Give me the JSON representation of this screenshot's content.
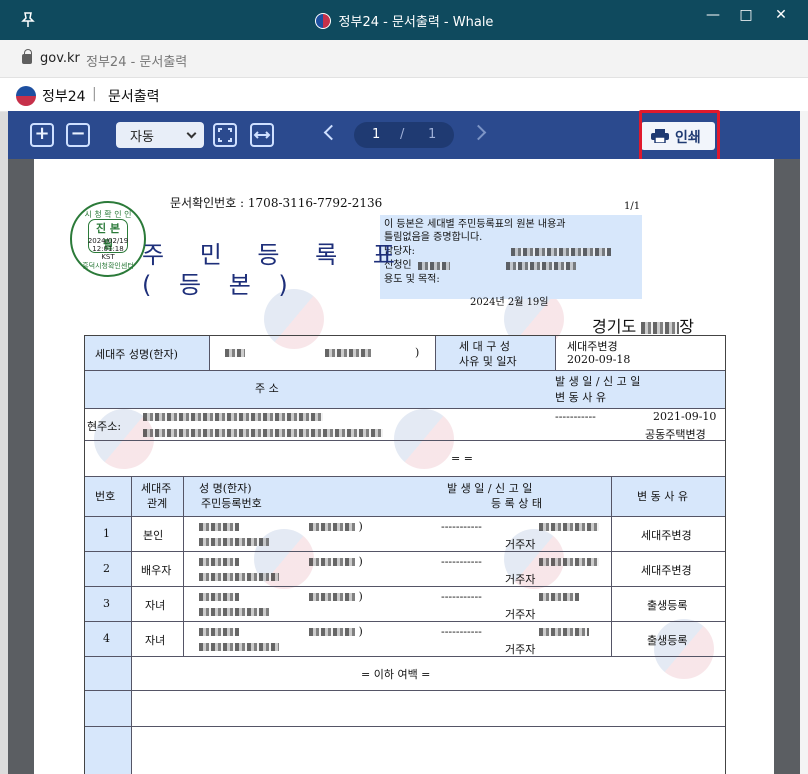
{
  "window": {
    "title": "정부24 - 문서출력 - Whale",
    "controls": [
      "—",
      "□",
      "✕"
    ]
  },
  "address": {
    "host": "gov.kr",
    "path": "정부24 - 문서출력"
  },
  "site": {
    "name": "정부24",
    "separator": "|",
    "page": "문서출력"
  },
  "toolbar": {
    "zoom_value": "자동",
    "page_current": "1",
    "page_sep": "/",
    "page_total": "1",
    "print_label": "인쇄"
  },
  "document": {
    "stamp": {
      "top": "시 청 확 인 인",
      "main": "진 본 필",
      "date": "2024/02/19",
      "time": "12:01:18",
      "tz": "KST",
      "bottom": "흥덕시청확인센터"
    },
    "doc_number": "문서확인번호 : 1708-3116-7792-2136",
    "page_of": "1/1",
    "cert_line1": "이 등본은 세대별 주민등록표의 원본 내용과",
    "cert_line2": "틀림없음을 증명합니다.",
    "cert_label_manager": "담당자:",
    "cert_label_applicant": "신청인",
    "cert_label_purpose": "용도 및 목적:",
    "title": "주 민 등 록 표",
    "subtitle": "( 등 본 )",
    "issue_date": "2024년 2월 19일",
    "issuer_prefix": "경기도",
    "issuer_suffix": "장",
    "head_name": "세대주 성명(한자)",
    "head_paren": ")",
    "composition_label1": "세 대 구 성",
    "composition_label2": "사유 및 일자",
    "composition_reason": "세대주변경",
    "composition_date": "2020-09-18",
    "address_header": "주          소",
    "address_hist_header1": "발 생 일  /  신 고 일",
    "address_hist_header2": "변    동    사    유",
    "address_label": "현주소:",
    "address_dash": "-----------",
    "address_date": "2021-09-10",
    "address_reason": "공동주택변경",
    "address_end": "= =",
    "col_no": "번호",
    "col_rel1": "세대주",
    "col_rel2": "관계",
    "col_name1": "성  명(한자)",
    "col_name2": "주민등록번호",
    "col_date": "발 생 일  /  신 고 일",
    "col_status": "등 록 상 태",
    "col_reason": "변 동 사 유",
    "rows": [
      {
        "no": "1",
        "rel": "본인",
        "dash": "-----------",
        "status": "거주자",
        "reason": "세대주변경"
      },
      {
        "no": "2",
        "rel": "배우자",
        "dash": "-----------",
        "status": "거주자",
        "reason": "세대주변경"
      },
      {
        "no": "3",
        "rel": "자녀",
        "dash": "-----------",
        "status": "거주자",
        "reason": "출생등록"
      },
      {
        "no": "4",
        "rel": "자녀",
        "dash": "-----------",
        "status": "거주자",
        "reason": "출생등록"
      }
    ],
    "end_note": "= 이하 여백 ="
  }
}
